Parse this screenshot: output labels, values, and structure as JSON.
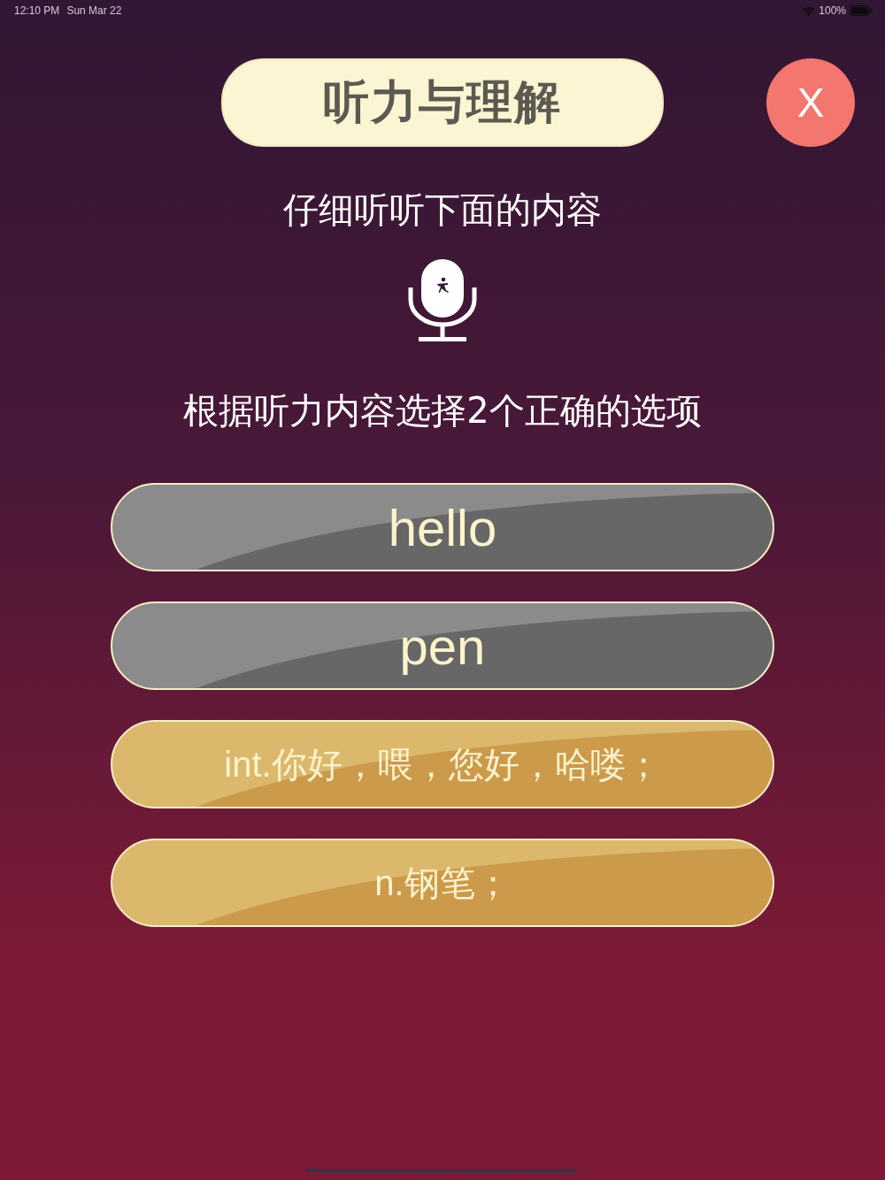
{
  "status_bar": {
    "time": "12:10 PM",
    "date": "Sun Mar 22",
    "battery": "100%"
  },
  "title": "听力与理解",
  "close_button": "X",
  "instruction": "仔细听听下面的内容",
  "question": "根据听力内容选择2个正确的选项",
  "options": [
    {
      "kind": "word",
      "label": "hello"
    },
    {
      "kind": "word",
      "label": "pen"
    },
    {
      "kind": "meaning",
      "label": "int.你好，喂，您好，哈喽；"
    },
    {
      "kind": "meaning",
      "label": "n.钢笔；"
    }
  ]
}
